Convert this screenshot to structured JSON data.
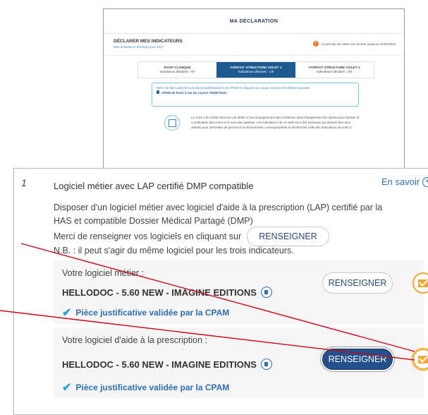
{
  "background": {
    "header_title": "MA DÉCLARATION",
    "section_title": "DÉCLARER MES INDICATEURS",
    "section_subtitle": "Mes indicateurs déclarés pour 2017",
    "alert_text": "La période de saisie est ouverte jusqu'au 31/01/2018",
    "tabs": [
      {
        "label": "ROSP CLINIQUE",
        "sub": "Indicateurs déclarés : 0/7"
      },
      {
        "label": "FORFAIT STRUCTURE VOLET 1",
        "sub": "Indicateurs déclarés : 1/5"
      },
      {
        "label": "FORFAIT STRUCTURE VOLET 2",
        "sub": "Indicateurs déclarés : 0/4"
      }
    ],
    "note_text": "Merci de faire parvenir vos pièces justificatives à la CPAM en cliquant sur",
    "note_text2": "ou par courrier à l'adresse suivante :",
    "note_address": "CPAM de Paris 3 rue du Louvre 75000 Paris",
    "info_text": "Le volet 1 du forfait structure est dédié à l'accompagnement des médecins dans l'équipement du cabinet pour faciliter la coordination des soins et le suivi des patients. Les indicateurs de ce volet sont des prérequis qui doivent être tous atteints pour permettre de percevoir la rémunération correspondante et déclencher celle des indicateurs du volet 2."
  },
  "indicator": {
    "number": "1",
    "title": "Logiciel métier avec LAP certifié DMP compatible",
    "more_link": "En savoir",
    "description": "Disposer d'un logiciel métier avec logiciel d'aide à la prescription (LAP) certifié par la HAS et compatible Dossier Médical Partagé (DMP)",
    "merci_text": "Merci de renseigner vos logiciels en cliquant sur",
    "renseigner_label": "RENSEIGNER",
    "nb_text": "N.B. : il peut s'agir du même logiciel pour les trois indicateurs.",
    "cards": [
      {
        "label": "Votre logiciel métier :",
        "value": "HELLODOC - 5.60 NEW - IMAGINE EDITIONS",
        "status": "Pièce justificative validée par la CPAM",
        "button": "RENSEIGNER"
      },
      {
        "label": "Votre logiciel d'aide à la prescription :",
        "value": "HELLODOC - 5.60 NEW - IMAGINE EDITIONS",
        "status": "Pièce justificative validée par la CPAM",
        "button": "RENSEIGNER"
      }
    ]
  },
  "colors": {
    "accent": "#2f6fb0",
    "primary_button": "#23508a",
    "mail_orange": "#f0a832",
    "annotation_red": "#d0021b"
  }
}
